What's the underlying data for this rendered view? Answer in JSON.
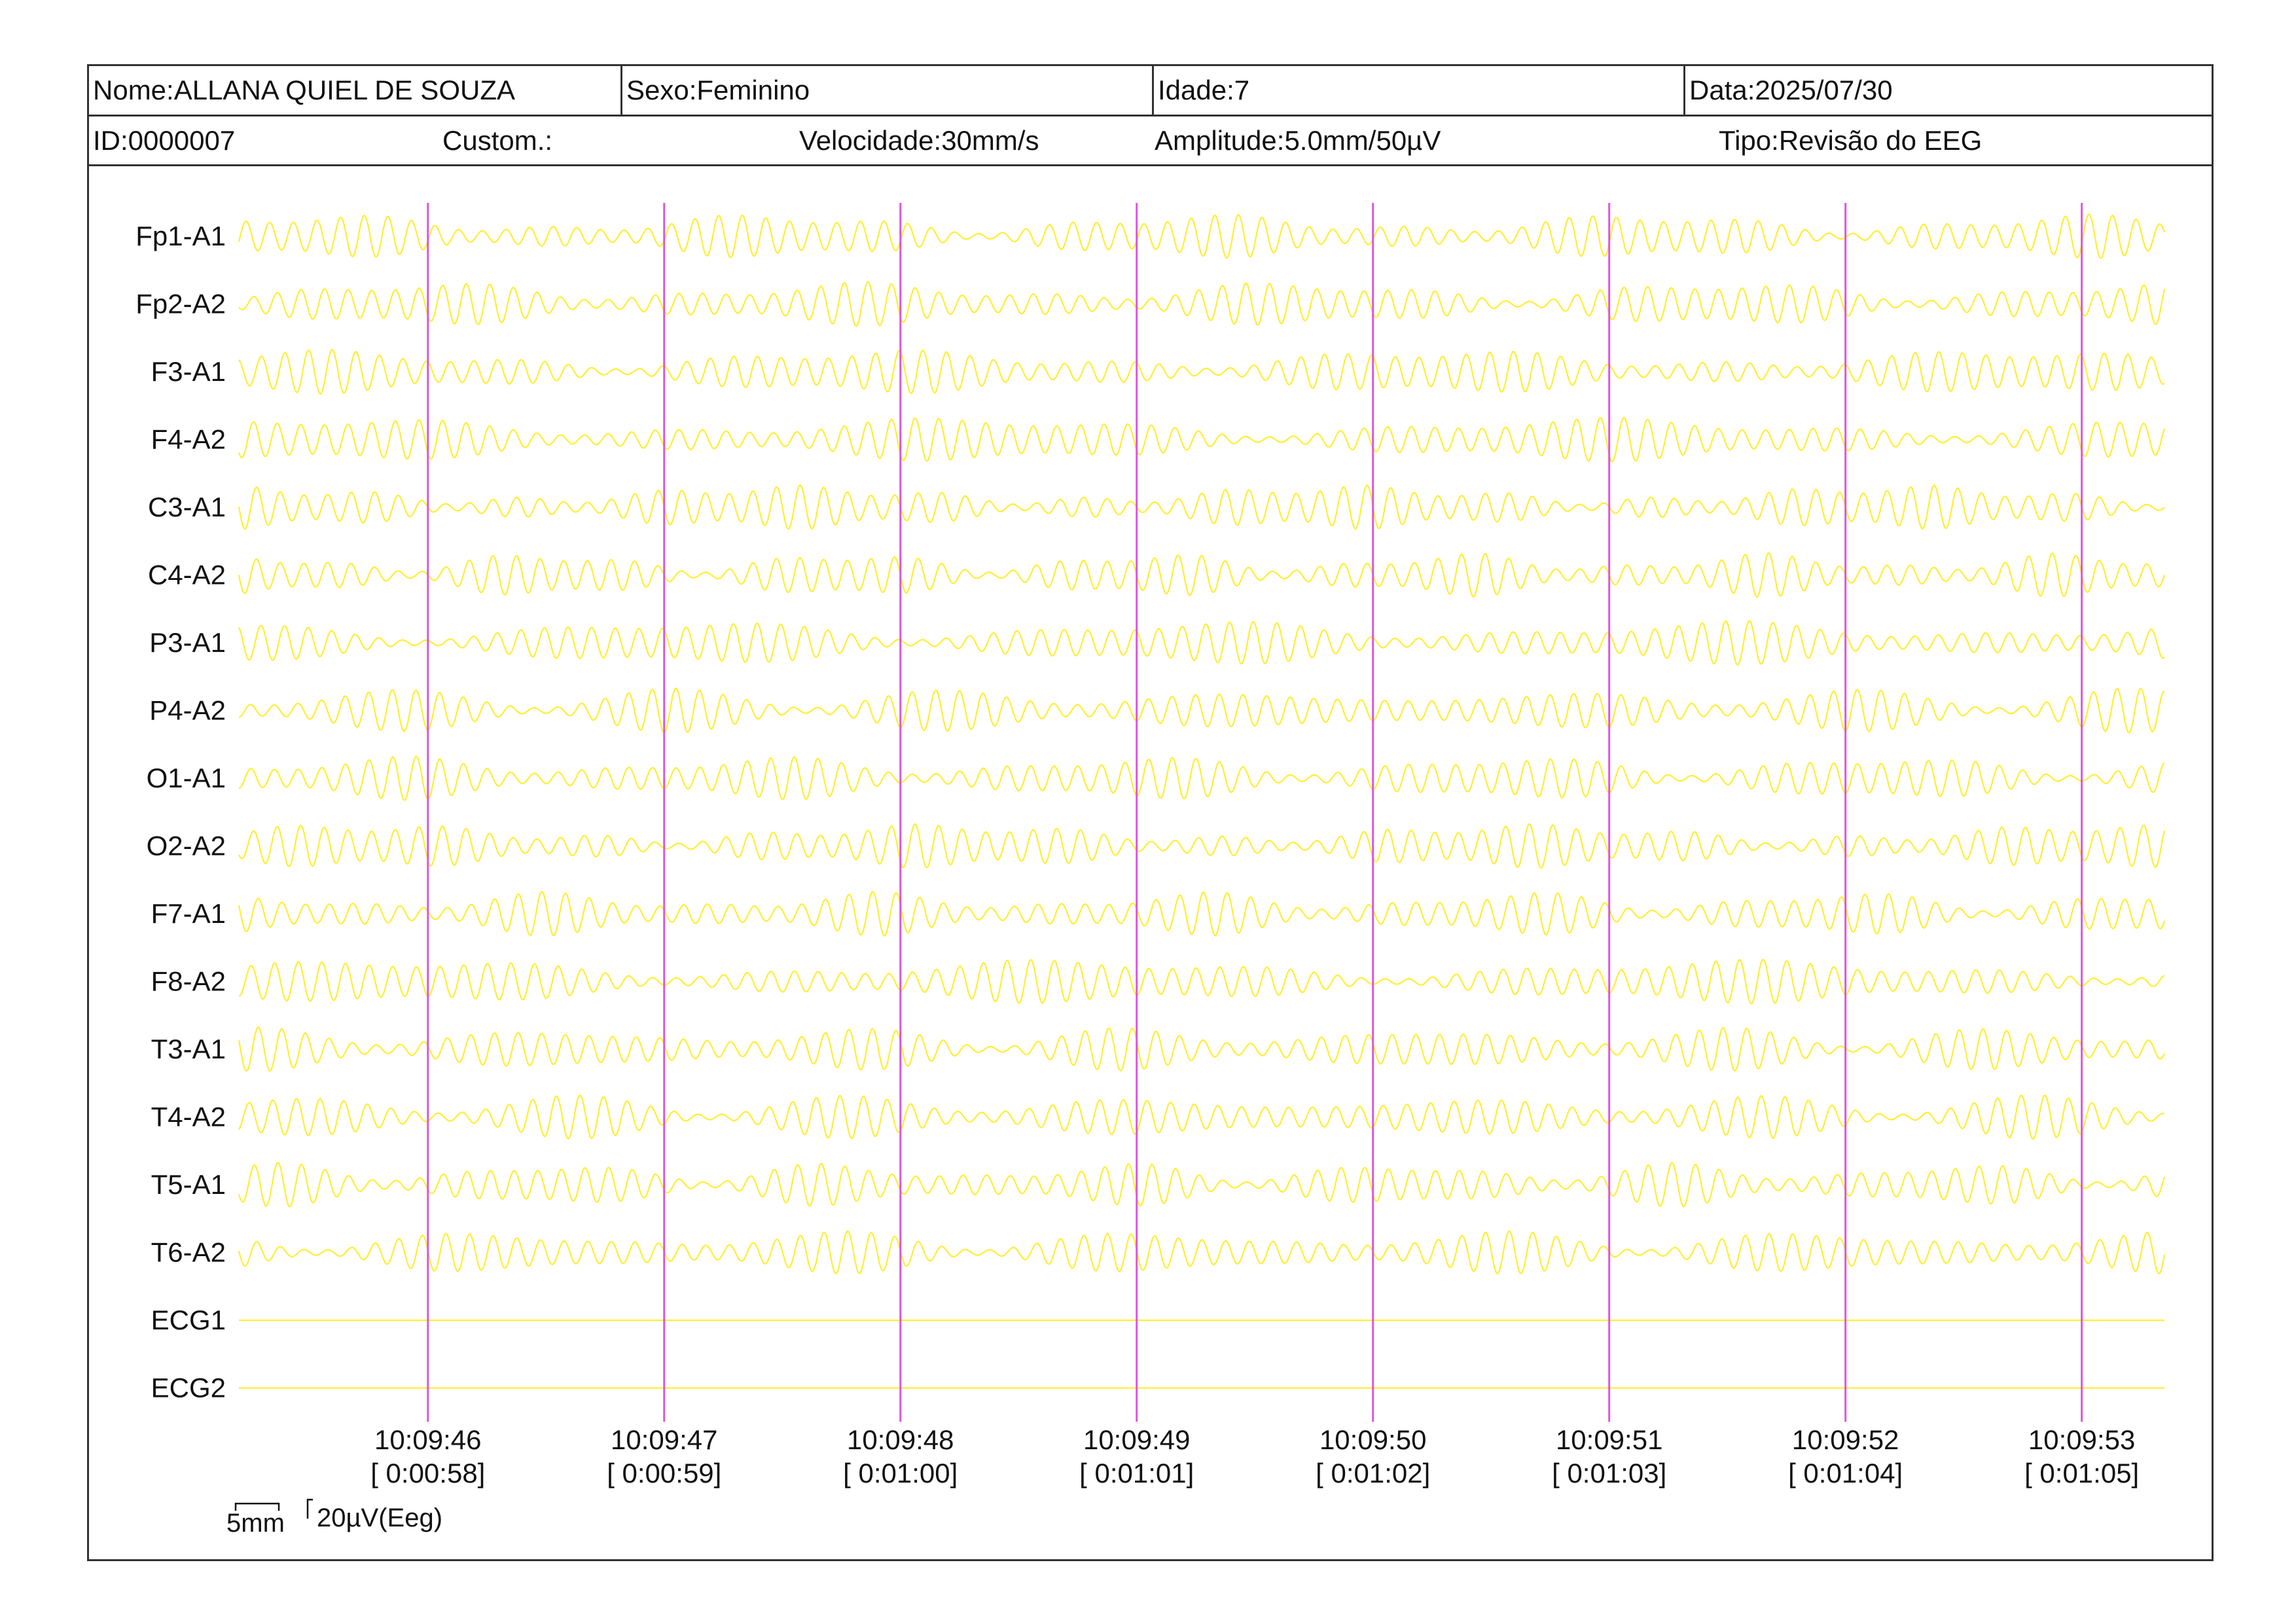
{
  "header": {
    "nome_label": "Nome:",
    "nome": "ALLANA QUIEL DE SOUZA",
    "sexo_label": "Sexo:",
    "sexo": "Feminino",
    "idade_label": "Idade:",
    "idade": "7",
    "data_label": "Data:",
    "data": "2025/07/30",
    "id_label": "ID:",
    "id": "0000007",
    "custom_label": "Custom.:",
    "custom": "",
    "velocidade_label": "Velocidade:",
    "velocidade": "30mm/s",
    "amplitude_label": "Amplitude:",
    "amplitude": "5.0mm/50µV",
    "tipo_label": "Tipo:",
    "tipo": "Revisão do EEG"
  },
  "scale": {
    "time_label": "5mm",
    "amp_label": "20µV(Eeg)"
  },
  "colors": {
    "trace": "#ffee33",
    "marker": "#dd55dd",
    "border": "#333333",
    "text": "#111111"
  },
  "chart_data": {
    "type": "line",
    "title": "",
    "xlabel": "",
    "ylabel": "",
    "grid": false,
    "channels": [
      "Fp1-A1",
      "Fp2-A2",
      "F3-A1",
      "F4-A2",
      "C3-A1",
      "C4-A2",
      "P3-A1",
      "P4-A2",
      "O1-A1",
      "O2-A2",
      "F7-A1",
      "F8-A2",
      "T3-A1",
      "T4-A2",
      "T5-A1",
      "T6-A2",
      "ECG1",
      "ECG2"
    ],
    "flat_channels": [
      "ECG1",
      "ECG2"
    ],
    "time_markers": [
      {
        "clock": "10:09:46",
        "elapsed": "[ 0:00:58]"
      },
      {
        "clock": "10:09:47",
        "elapsed": "[ 0:00:59]"
      },
      {
        "clock": "10:09:48",
        "elapsed": "[ 0:01:00]"
      },
      {
        "clock": "10:09:49",
        "elapsed": "[ 0:01:01]"
      },
      {
        "clock": "10:09:50",
        "elapsed": "[ 0:01:02]"
      },
      {
        "clock": "10:09:51",
        "elapsed": "[ 0:01:03]"
      },
      {
        "clock": "10:09:52",
        "elapsed": "[ 0:01:04]"
      },
      {
        "clock": "10:09:53",
        "elapsed": "[ 0:01:05]"
      }
    ],
    "seconds_before_first_marker": 0.8,
    "seconds_after_last_marker": 0.35,
    "waveform_frequency_hz": 10
  }
}
